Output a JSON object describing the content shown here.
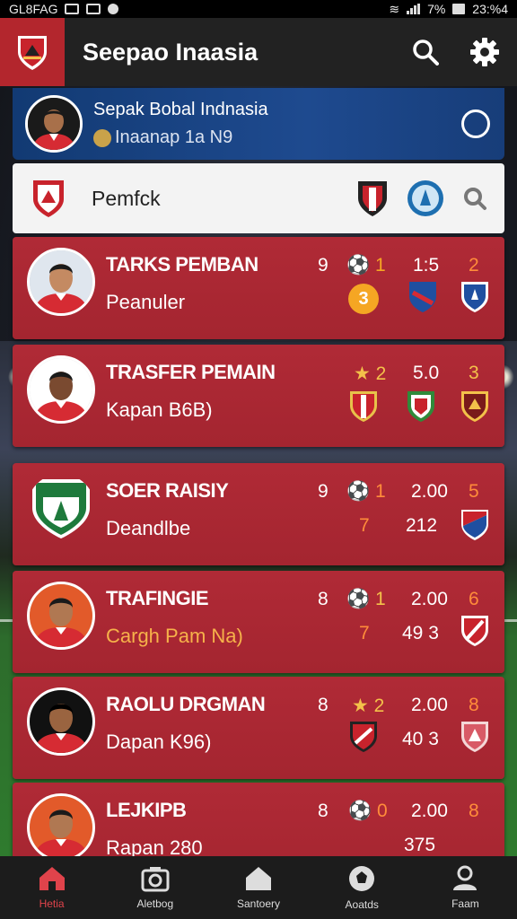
{
  "status_bar": {
    "left_text": "GL8FAG",
    "signal_text": "7%",
    "time": "23:%4"
  },
  "header": {
    "title": "Seepao Inaasia",
    "search_icon": "search-icon",
    "settings_icon": "gear-icon"
  },
  "profile": {
    "name": "Sepak Bobal Indnasia",
    "subtitle": "Inaanap 1a N9"
  },
  "search": {
    "text": "Pemfck"
  },
  "rows": [
    {
      "title": "TARKS PEMBAN",
      "sub": "Peanuler",
      "s1": "9",
      "s2": "⚽ 1",
      "s3": "1:5",
      "s4": "2",
      "badge": "3",
      "sub_color": "white"
    },
    {
      "title": "TRASFER PEMAIN",
      "sub": "Kapan B6B)",
      "s1": "",
      "s2": "★ 2",
      "s3": "5.0",
      "s4": "3",
      "badge": "",
      "sub_color": "white"
    },
    {
      "title": "SOER RAISIY",
      "sub": "Deandlbe",
      "s1": "9",
      "s2": "⚽ 1",
      "s3": "2.00",
      "s4": "5",
      "s5": "7",
      "s6": "212",
      "sub_color": "white"
    },
    {
      "title": "TRAFINGIE",
      "sub": "Cargh Pam Na)",
      "s1": "8",
      "s2": "⚽ 1",
      "s3": "2.00",
      "s4": "6",
      "s5": "7",
      "s6": "49 3",
      "sub_color": "gold"
    },
    {
      "title": "RAOLU DRGMAN",
      "sub": "Dapan K96)",
      "s1": "8",
      "s2": "★ 2",
      "s3": "2.00",
      "s4": "8",
      "s6": "40 3",
      "sub_color": "white"
    },
    {
      "title": "LEJKIPB",
      "sub": "Rapan 280",
      "s1": "8",
      "s2": "⚽ 0",
      "s3": "2.00",
      "s4": "8",
      "s6": "375",
      "sub_color": "white"
    }
  ],
  "nav": [
    {
      "label": "Hetia",
      "icon": "home-icon",
      "active": true
    },
    {
      "label": "Aletbog",
      "icon": "camera-icon",
      "active": false
    },
    {
      "label": "Santoery",
      "icon": "house-icon",
      "active": false
    },
    {
      "label": "Aoatds",
      "icon": "football-icon",
      "active": false
    },
    {
      "label": "Faam",
      "icon": "user-icon",
      "active": false
    }
  ],
  "colors": {
    "accent": "#b02a36",
    "nav_active": "#e0434b",
    "profile_bg": "#1e4a8f"
  }
}
